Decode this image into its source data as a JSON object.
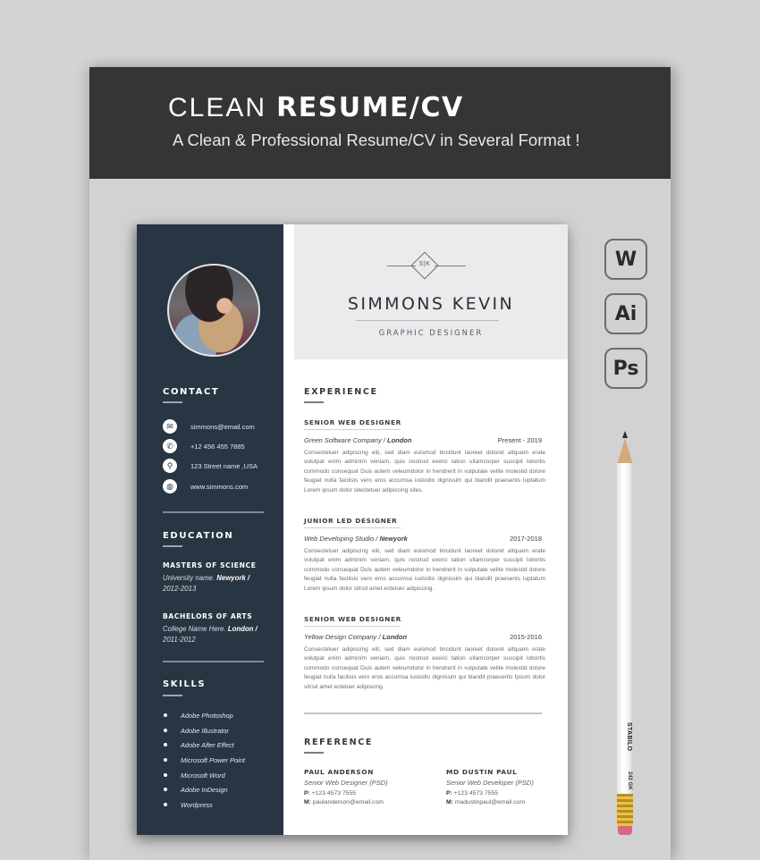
{
  "banner": {
    "title_light": "CLEAN",
    "title_bold": "RESUME/CV",
    "subtitle": "A Clean & Professional Resume/CV in Several Format !"
  },
  "formats": [
    {
      "label": "W",
      "icon": "word-icon"
    },
    {
      "label": "Ai",
      "icon": "illustrator-icon"
    },
    {
      "label": "Ps",
      "icon": "photoshop-icon"
    }
  ],
  "pencil": {
    "brand": "STABILO",
    "code": "242 GK"
  },
  "resume": {
    "monogram": "S|K",
    "name": "SIMMONS KEVIN",
    "role": "GRAPHIC DESIGNER",
    "sidebar": {
      "contact": {
        "heading": "CONTACT",
        "items": [
          {
            "icon": "email-icon",
            "glyph": "✉",
            "text": "simmons@email.com"
          },
          {
            "icon": "phone-icon",
            "glyph": "✆",
            "text": "+12 456 455 7885"
          },
          {
            "icon": "location-pin-icon",
            "glyph": "⚲",
            "text": "123 Street name ,USA"
          },
          {
            "icon": "globe-icon",
            "glyph": "◍",
            "text": "www.simmons.com"
          }
        ]
      },
      "education": {
        "heading": "EDUCATION",
        "items": [
          {
            "degree": "MASTERS OF SCIENCE",
            "school": "University name.",
            "city": "Newyork /",
            "years": "2012-2013"
          },
          {
            "degree": "BACHELORS OF ARTS",
            "school": "College Name Here.",
            "city": "London /",
            "years": "2011-2012"
          }
        ]
      },
      "skills": {
        "heading": "SKILLS",
        "items": [
          "Adobe Photoshop",
          "Adobe Illustrator",
          "Adobe After Effect",
          "Microsoft Power Point",
          "Microsoft Word",
          "Adobe InDesign",
          "Wordpress"
        ]
      }
    },
    "experience": {
      "heading": "EXPERIENCE",
      "jobs": [
        {
          "title": "SENIOR WEB DESIGNER",
          "company": "Green Software Company /",
          "city": "London",
          "dates": "Present - 2019",
          "description": "Consectetuer adipiscing elit, sed diam euismod tincidunt laoreet doloret altquam erate volutpat enim adminim veniam, quis nostrud exerci tation ullamcorper suscipit lobortis commodo consequat Duis autem veleumdolor in hendrerit in vulputate velite molestid dolore feugiat nulla facilisis vero eros accumsa iustodio dignissim qui blandit praesents luptatum Lorem ipsum dolor sitectetuer adipiscing sites."
        },
        {
          "title": "JUNIOR LED DESIGNER",
          "company": "Web Developing Studio /",
          "city": "Newyork",
          "dates": "2017-2018",
          "description": "Consectetuer adipiscing elit, sed diam euismod tincidunt laoreet doloret altquam erate volutpat enim adminim veniam, quis nostrud exerci tation ullamcorper suscipit lobortis commodo consequat Duis autem veleumdolor in hendrerit in vulputate velite molestid dolore feugiat nulla facilisis vero eros accumsa iustodio dignissim qui blandit praesents luptatum Lorem ipsum dolor sitrsd amet ectetuer adipiscing."
        },
        {
          "title": "SENIOR WEB DESIGNER",
          "company": "Yellow Design Company /",
          "city": "London",
          "dates": "2015-2016",
          "description": "Consectetuer adipiscing elit, sed diam euismod tincidunt laoreet doloret altquam erate volutpat enim adminim veniam, quis nostrud exerci tation ullamcorper suscipit lobortis commodo consequat Duis autem veleumdolor in hendrerit in vulputate velite molestid dolore feugiat nulla facilisis vero eros accumsa iustodio dignissim qui blandit praesents Ipsum dolor sitrsd amet ectetuer adipiscing."
        }
      ]
    },
    "reference": {
      "heading": "REFERENCE",
      "people": [
        {
          "name": "PAUL ANDERSON",
          "role": "Senior Web Designer (PSD)",
          "phone_label": "P:",
          "phone": "+123 4573 7555",
          "mail_label": "M:",
          "email": "paulanderson@email.com"
        },
        {
          "name": "MD DUSTIN PAUL",
          "role": "Senior Web Developer (PSD)",
          "phone_label": "P:",
          "phone": "+123 4573 7555",
          "mail_label": "M:",
          "email": "madustinpaul@email.com"
        }
      ]
    }
  }
}
